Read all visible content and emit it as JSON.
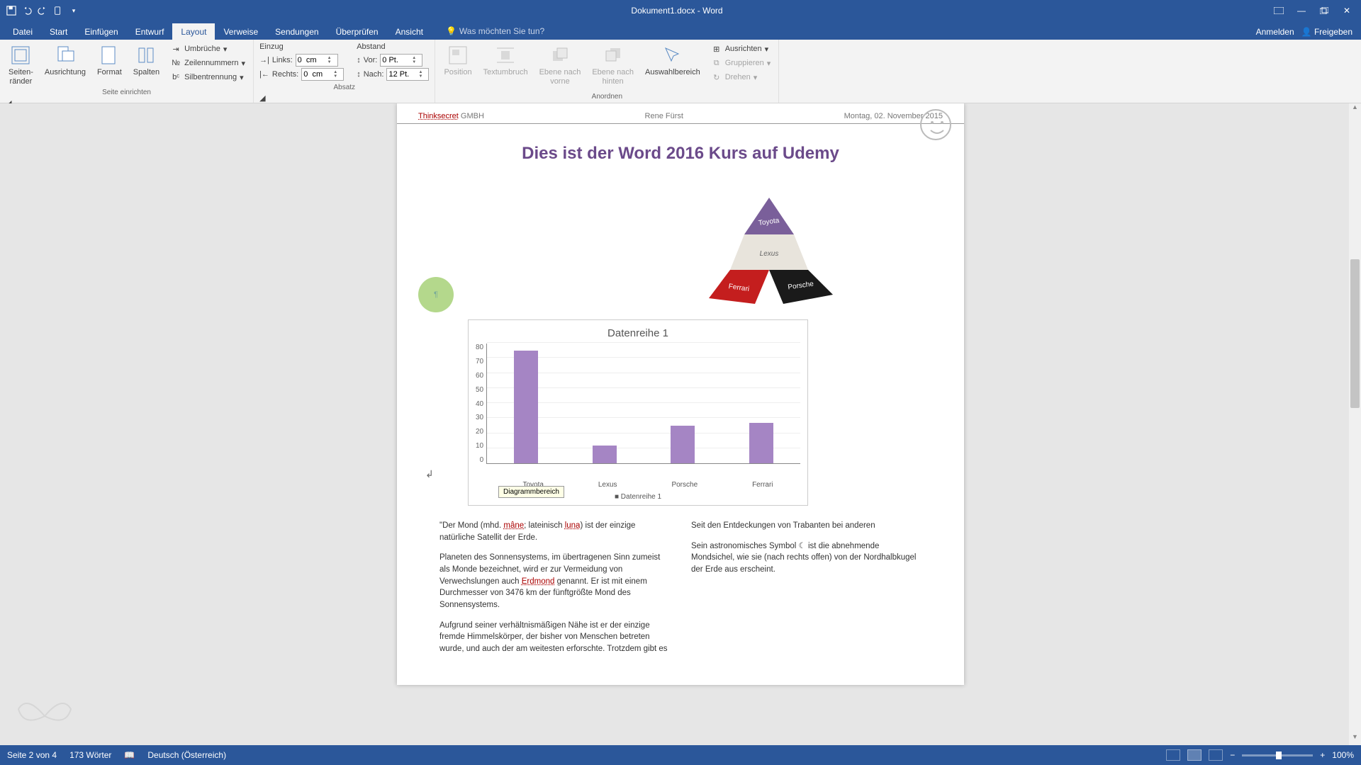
{
  "app": {
    "title": "Dokument1.docx - Word"
  },
  "qat": {
    "save": "save",
    "undo": "undo",
    "redo": "redo",
    "touch": "touch-mode",
    "more": "customize"
  },
  "tabs": {
    "items": [
      "Datei",
      "Start",
      "Einfügen",
      "Entwurf",
      "Layout",
      "Verweise",
      "Sendungen",
      "Überprüfen",
      "Ansicht"
    ],
    "active": 4,
    "tell_me": "Was möchten Sie tun?",
    "signin": "Anmelden",
    "share": "Freigeben"
  },
  "ribbon": {
    "page_setup": {
      "label": "Seite einrichten",
      "margins": "Seiten-\nränder",
      "orientation": "Ausrichtung",
      "size": "Format",
      "columns": "Spalten",
      "breaks": "Umbrüche",
      "line_numbers": "Zeilennummern",
      "hyphenation": "Silbentrennung"
    },
    "paragraph": {
      "label": "Absatz",
      "indent_title": "Einzug",
      "left_lbl": "Links:",
      "right_lbl": "Rechts:",
      "left_val": "0  cm",
      "right_val": "0  cm",
      "spacing_title": "Abstand",
      "before_lbl": "Vor:",
      "after_lbl": "Nach:",
      "before_val": "0 Pt.",
      "after_val": "12 Pt."
    },
    "arrange": {
      "label": "Anordnen",
      "position": "Position",
      "wrap": "Textumbruch",
      "forward": "Ebene nach\nvorne",
      "backward": "Ebene nach\nhinten",
      "selection": "Auswahlbereich",
      "align": "Ausrichten",
      "group": "Gruppieren",
      "rotate": "Drehen"
    }
  },
  "doc": {
    "header_left_underlined": "Thinksecret",
    "header_left_rest": " GMBH",
    "header_center": "Rene Fürst",
    "header_right": "Montag, 02. November 2015",
    "title": "Dies ist der Word 2016 Kurs auf Udemy",
    "pyramid_labels": {
      "top": "Toyota",
      "mid": "Lexus",
      "left": "Ferrari",
      "right": "Porsche"
    },
    "tooltip": "Diagrammbereich",
    "col1_p1_a": "\"Der Mond (mhd. ",
    "col1_p1_u1": "mâne",
    "col1_p1_b": "; lateinisch ",
    "col1_p1_u2": "luna",
    "col1_p1_c": ") ist der einzige natürliche Satellit der Erde.",
    "col1_p2_a": "Planeten des Sonnensystems, im übertragenen Sinn zumeist als Monde bezeichnet, wird er zur Vermeidung von Verwechslungen auch ",
    "col1_p2_u": "Erdmond",
    "col1_p2_b": " genannt. Er ist mit einem Durchmesser von 3476 km der fünftgrößte Mond des Sonnensystems.",
    "col1_p3": "Aufgrund seiner verhältnismäßigen Nähe ist er der einzige fremde Himmelskörper, der bisher von Menschen betreten wurde, und auch der am weitesten erforschte. Trotzdem gibt es",
    "col2_p1": "Seit den Entdeckungen von Trabanten bei anderen",
    "col2_p2": "Sein astronomisches Symbol ☾ ist die abnehmende Mondsichel, wie sie (nach rechts offen) von der Nordhalbkugel der Erde aus erscheint."
  },
  "chart_data": {
    "type": "bar",
    "title": "Datenreihe 1",
    "categories": [
      "Toyota",
      "Lexus",
      "Porsche",
      "Ferrari"
    ],
    "values": [
      75,
      12,
      25,
      27
    ],
    "ylim": [
      0,
      80
    ],
    "yticks": [
      0,
      10,
      20,
      30,
      40,
      50,
      60,
      70,
      80
    ],
    "legend": "Datenreihe 1",
    "bar_color": "#a585c4"
  },
  "status": {
    "page": "Seite 2 von 4",
    "words": "173 Wörter",
    "lang": "Deutsch (Österreich)",
    "zoom": "100%"
  }
}
